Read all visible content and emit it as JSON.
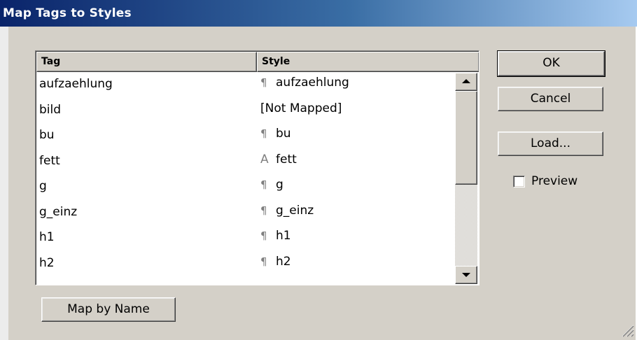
{
  "window": {
    "title": "Map Tags to Styles"
  },
  "list": {
    "columns": {
      "tag": "Tag",
      "style": "Style"
    },
    "rows": [
      {
        "tag": "aufzaehlung",
        "style_icon": "¶",
        "style": "aufzaehlung"
      },
      {
        "tag": "bild",
        "style_icon": "",
        "style": "[Not Mapped]"
      },
      {
        "tag": "bu",
        "style_icon": "¶",
        "style": "bu"
      },
      {
        "tag": "fett",
        "style_icon": "A",
        "style": "fett"
      },
      {
        "tag": "g",
        "style_icon": "¶",
        "style": "g"
      },
      {
        "tag": "g_einz",
        "style_icon": "¶",
        "style": "g_einz"
      },
      {
        "tag": "h1",
        "style_icon": "¶",
        "style": "h1"
      },
      {
        "tag": "h2",
        "style_icon": "¶",
        "style": "h2"
      }
    ]
  },
  "buttons": {
    "ok": "OK",
    "cancel": "Cancel",
    "load": "Load...",
    "map_by_name": "Map by Name"
  },
  "preview": {
    "label": "Preview",
    "checked": false
  },
  "colors": {
    "dialog_face": "#d4d0c8",
    "titlebar_start": "#0a246a",
    "titlebar_end": "#a6caf0",
    "style_icon": "#808080"
  },
  "icons": {
    "paragraph_style": "pilcrow-icon",
    "character_style": "character-style-icon",
    "scroll_up": "scroll-up-arrow-icon",
    "scroll_down": "scroll-down-arrow-icon",
    "resize_grip": "resize-grip-icon"
  }
}
